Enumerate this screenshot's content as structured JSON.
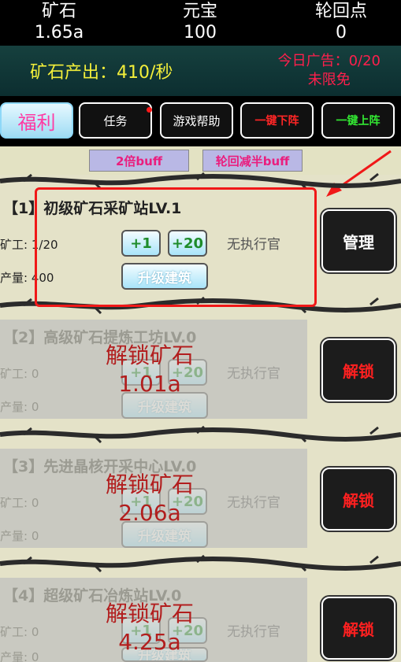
{
  "top_stats": [
    {
      "label": "矿石",
      "value": "1.65a"
    },
    {
      "label": "元宝",
      "value": "100"
    },
    {
      "label": "轮回点",
      "value": "0"
    }
  ],
  "output_text": "矿石产出：410/秒",
  "ad": {
    "line1": "今日广告：0/20",
    "line2": "未限免"
  },
  "buttons": {
    "fuli": "福利",
    "task": "任务",
    "help": "游戏帮助",
    "oneclick_down": "一键下阵",
    "oneclick_up": "一键上阵"
  },
  "buffs": {
    "double": "2倍buff",
    "half": "轮回减半buff"
  },
  "labels": {
    "miner": "矿工:",
    "output": "产量:",
    "plus1": "+1",
    "plus20": "+20",
    "upgrade": "升级建筑",
    "officer": "无执行官",
    "manage": "管理",
    "unlock": "解锁",
    "unlock_cost_label": "解锁矿石"
  },
  "stations": [
    {
      "title": "【1】初级矿石采矿站LV.1",
      "miners": "1/20",
      "production": "400",
      "locked": false
    },
    {
      "title": "【2】高级矿石提炼工坊LV.0",
      "miners": "0",
      "production": "0",
      "locked": true,
      "cost": "1.01a"
    },
    {
      "title": "【3】先进晶核开采中心LV.0",
      "miners": "0",
      "production": "0",
      "locked": true,
      "cost": "2.06a"
    },
    {
      "title": "【4】超级矿石冶炼站LV.0",
      "miners": "0",
      "production": "0",
      "locked": true,
      "cost": "4.25a"
    }
  ],
  "colors": {
    "highlight": "#f01818",
    "output": "#f3ef3a",
    "ad": "#ff1f4c",
    "unlock_cost": "#b21e1e"
  }
}
